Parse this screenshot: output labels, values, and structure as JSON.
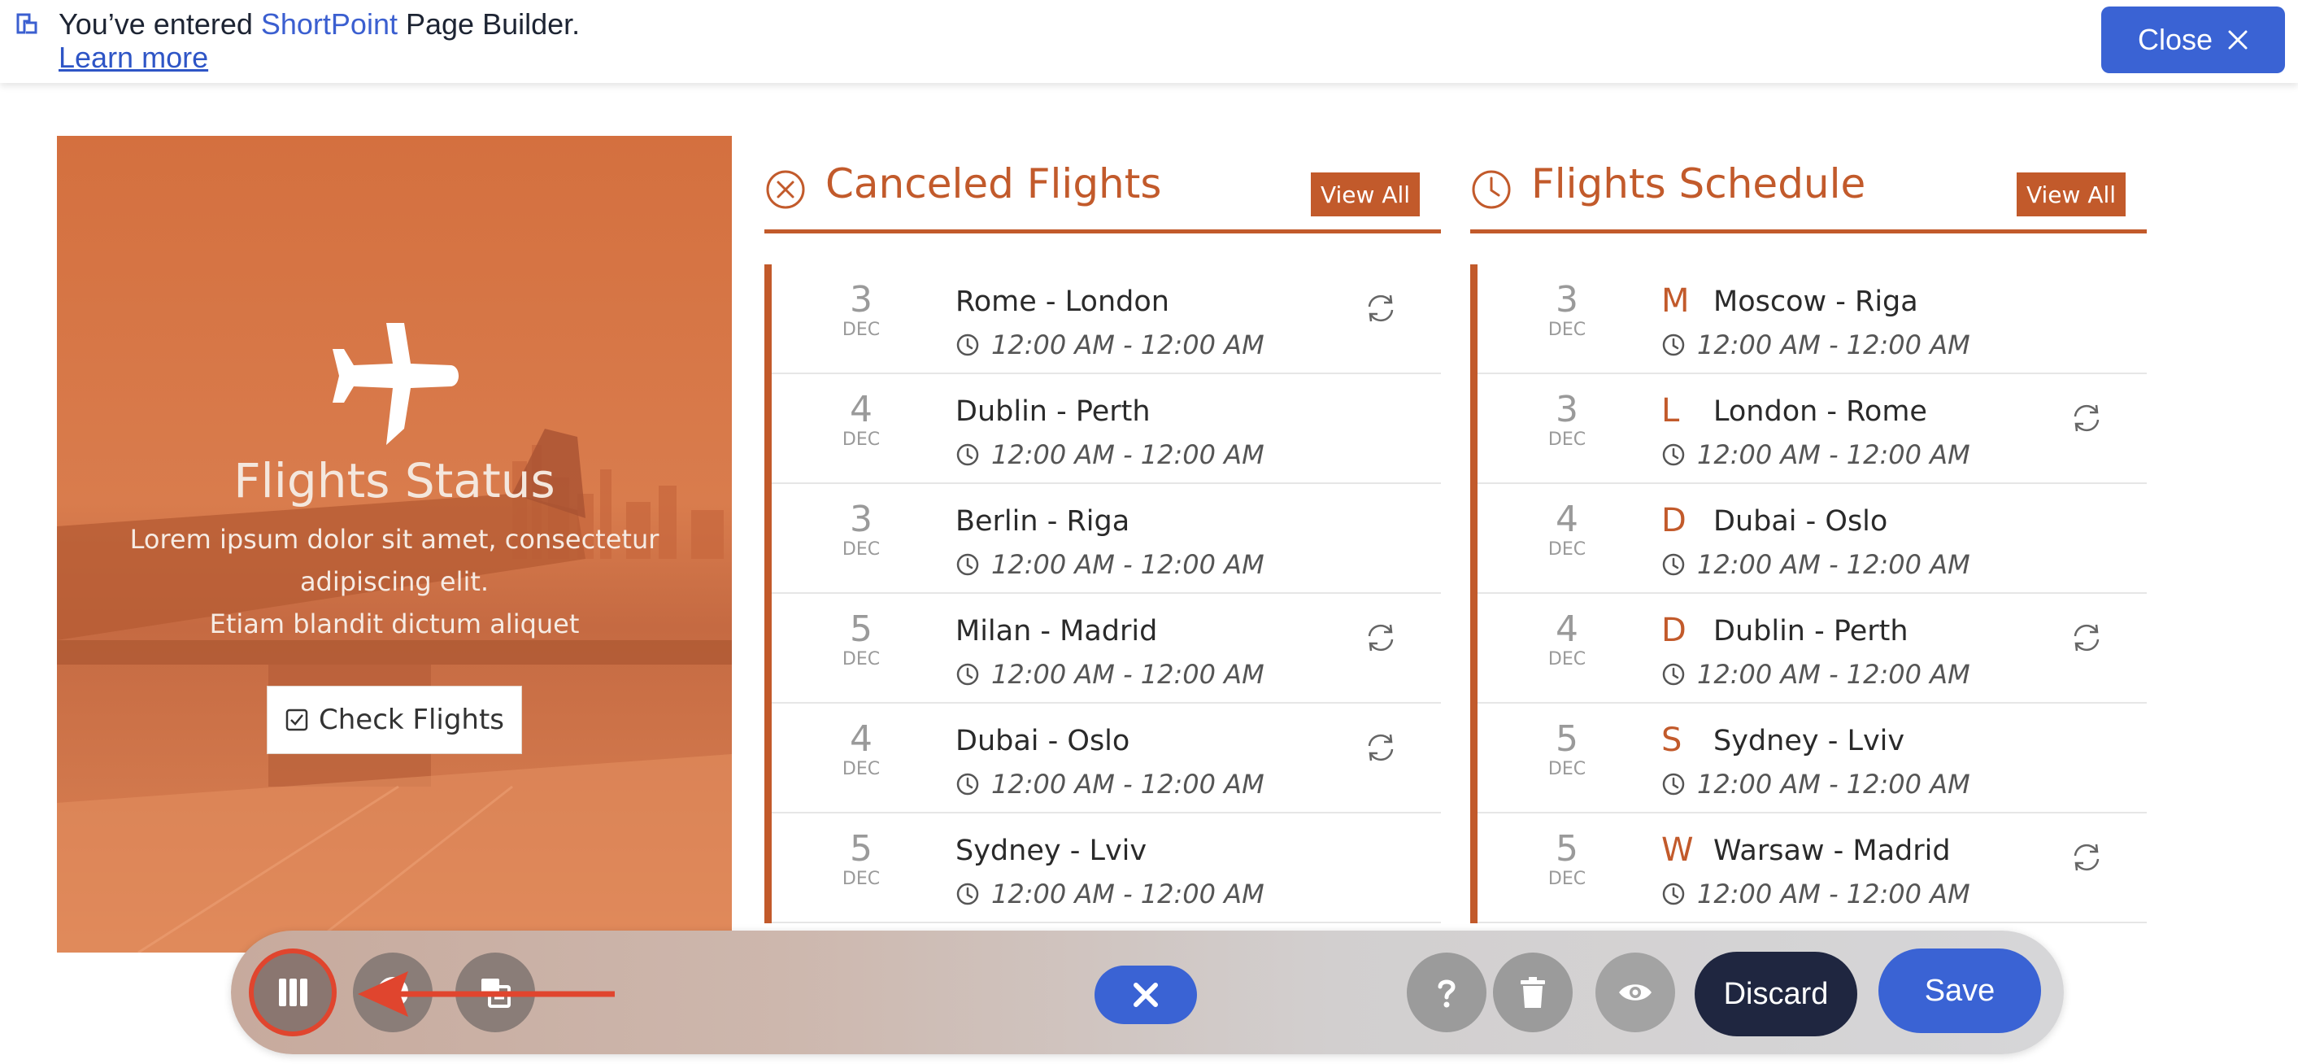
{
  "banner": {
    "prefix": "You’ve entered ",
    "brand": "ShortPoint",
    "suffix": " Page Builder.",
    "learn_more": "Learn more",
    "close_label": "Close"
  },
  "hero": {
    "title": "Flights Status",
    "description_line1": "Lorem ipsum dolor sit amet, consectetur adipiscing elit.",
    "description_line2": "Etiam blandit dictum aliquet",
    "button_label": "Check Flights",
    "icon": "airplane-icon"
  },
  "canceled": {
    "title": "Canceled Flights",
    "view_all": "View All",
    "icon": "x-circle-icon",
    "rows": [
      {
        "day": "3",
        "month": "DEC",
        "route": "Rome - London",
        "time": "12:00 AM - 12:00 AM",
        "refresh": true
      },
      {
        "day": "4",
        "month": "DEC",
        "route": "Dublin - Perth",
        "time": "12:00 AM - 12:00 AM",
        "refresh": false
      },
      {
        "day": "3",
        "month": "DEC",
        "route": "Berlin - Riga",
        "time": "12:00 AM - 12:00 AM",
        "refresh": false
      },
      {
        "day": "5",
        "month": "DEC",
        "route": "Milan - Madrid",
        "time": "12:00 AM - 12:00 AM",
        "refresh": true
      },
      {
        "day": "4",
        "month": "DEC",
        "route": "Dubai - Oslo",
        "time": "12:00 AM - 12:00 AM",
        "refresh": true
      },
      {
        "day": "5",
        "month": "DEC",
        "route": "Sydney - Lviv",
        "time": "12:00 AM - 12:00 AM",
        "refresh": false
      }
    ]
  },
  "schedule": {
    "title": "Flights Schedule",
    "view_all": "View All",
    "icon": "clock-icon",
    "rows": [
      {
        "day": "3",
        "month": "DEC",
        "letter": "M",
        "route": "Moscow - Riga",
        "time": "12:00 AM - 12:00 AM",
        "refresh": false
      },
      {
        "day": "3",
        "month": "DEC",
        "letter": "L",
        "route": "London - Rome",
        "time": "12:00 AM - 12:00 AM",
        "refresh": true
      },
      {
        "day": "4",
        "month": "DEC",
        "letter": "D",
        "route": "Dubai - Oslo",
        "time": "12:00 AM - 12:00 AM",
        "refresh": false
      },
      {
        "day": "4",
        "month": "DEC",
        "letter": "D",
        "route": "Dublin - Perth",
        "time": "12:00 AM - 12:00 AM",
        "refresh": true
      },
      {
        "day": "5",
        "month": "DEC",
        "letter": "S",
        "route": "Sydney - Lviv",
        "time": "12:00 AM - 12:00 AM",
        "refresh": false
      },
      {
        "day": "5",
        "month": "DEC",
        "letter": "W",
        "route": "Warsaw - Madrid",
        "time": "12:00 AM - 12:00 AM",
        "refresh": true
      }
    ]
  },
  "toolbar": {
    "discard_label": "Discard",
    "save_label": "Save",
    "icons": [
      "columns-icon",
      "style-icon",
      "layers-icon",
      "close-icon",
      "help-icon",
      "trash-icon",
      "eye-icon"
    ]
  },
  "colors": {
    "accent": "#c25a2b",
    "primary": "#3a63d4",
    "dark": "#1f2640",
    "highlight": "#e0452e"
  }
}
